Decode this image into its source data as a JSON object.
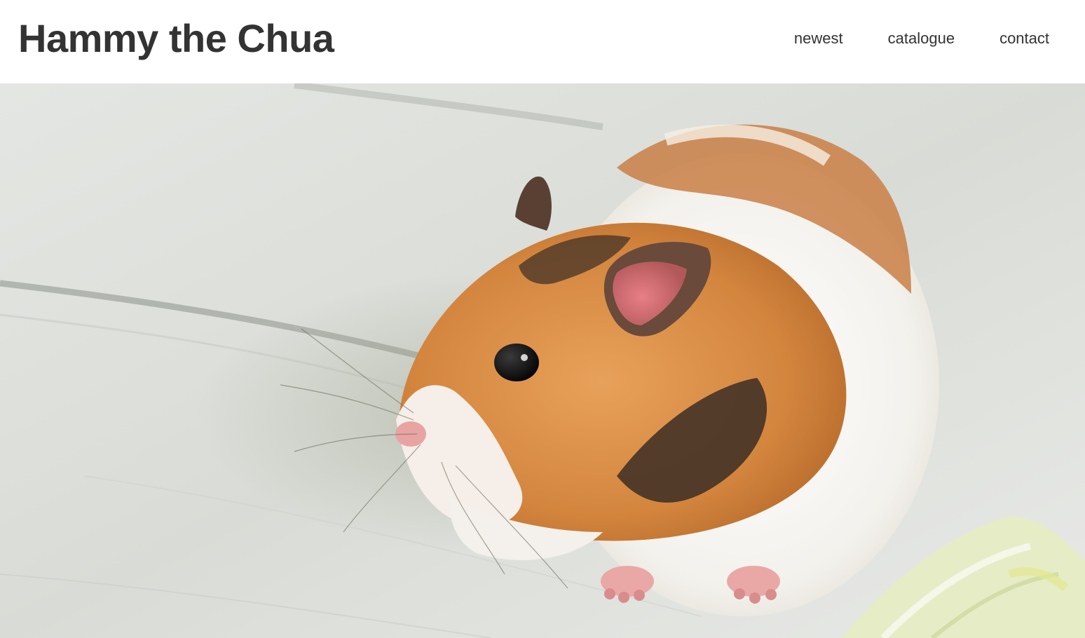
{
  "site": {
    "title": "Hammy the Chua"
  },
  "nav": {
    "items": [
      {
        "label": "newest"
      },
      {
        "label": "catalogue"
      },
      {
        "label": "contact"
      }
    ]
  },
  "hero": {
    "subject": "hamster",
    "colors": {
      "fur_orange": "#d9914a",
      "fur_white": "#f7f5f1",
      "fur_dark": "#3b2e25",
      "floor": "#e1e3e0",
      "celery": "#e6ecc6"
    }
  },
  "colors": {
    "text": "#333333",
    "background": "#ffffff"
  }
}
